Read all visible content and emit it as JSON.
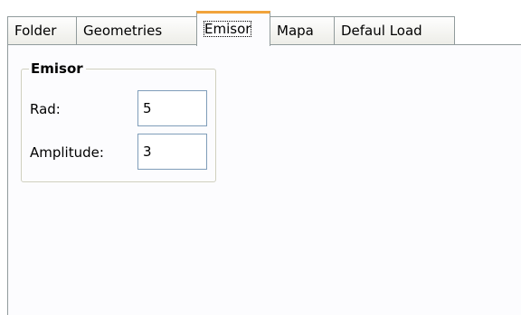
{
  "tabs": [
    {
      "label": "Folder",
      "active": false
    },
    {
      "label": "Geometries",
      "active": false
    },
    {
      "label": "Emisor",
      "active": true
    },
    {
      "label": "Mapa",
      "active": false
    },
    {
      "label": "Defaul Load",
      "active": false
    }
  ],
  "emisor_group": {
    "title": "Emisor",
    "rad": {
      "label": "Rad:",
      "value": "5"
    },
    "amplitude": {
      "label": "Amplitude:",
      "value": "3"
    }
  },
  "colors": {
    "active_tab_accent": "#f1a33b",
    "tab_border": "#919b9c",
    "input_border": "#7f9db9",
    "panel_background": "#fcfcfe"
  }
}
